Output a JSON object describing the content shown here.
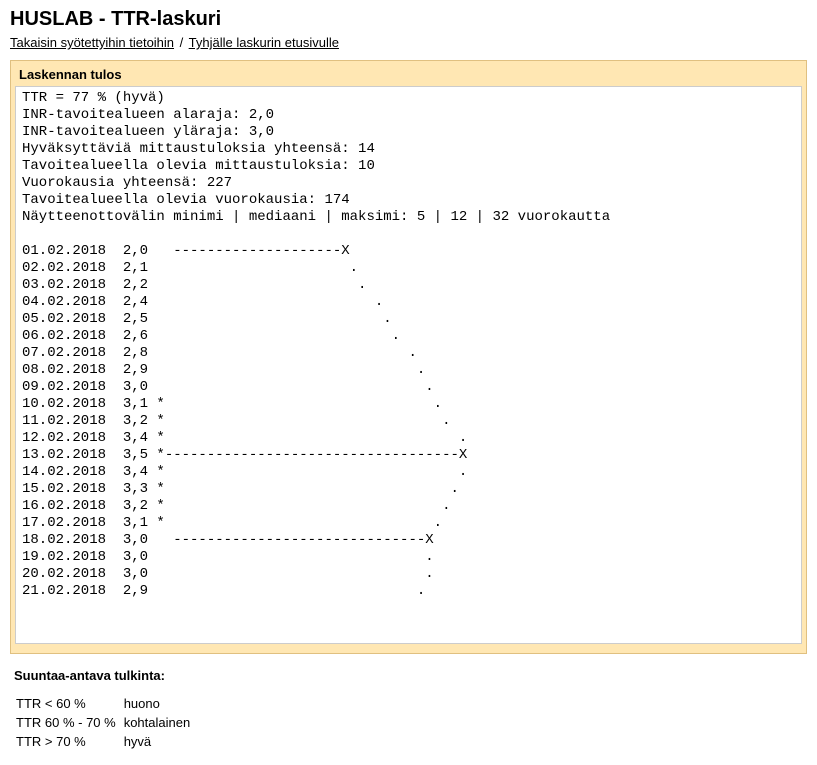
{
  "header": {
    "title": "HUSLAB - TTR-laskuri",
    "link_back": "Takaisin syötettyihin tietoihin",
    "link_empty": "Tyhjälle laskurin etusivulle",
    "separator": "/"
  },
  "panel": {
    "title": "Laskennan tulos"
  },
  "results": {
    "summary": [
      "TTR = 77 % (hyvä)",
      "INR-tavoitealueen alaraja: 2,0",
      "INR-tavoitealueen yläraja: 3,0",
      "Hyväksyttäviä mittaustuloksia yhteensä: 14",
      "Tavoitealueella olevia mittaustuloksia: 10",
      "Vuorokausia yhteensä: 227",
      "Tavoitealueella olevia vuorokausia: 174",
      "Näytteenottovälin minimi | mediaani | maksimi: 5 | 12 | 32 vuorokautta"
    ],
    "rows": [
      {
        "date": "01.02.2018",
        "value": "2,0",
        "flag": " ",
        "graph": " --------------------X                "
      },
      {
        "date": "02.02.2018",
        "value": "2,1",
        "flag": " ",
        "graph": "                      .               "
      },
      {
        "date": "03.02.2018",
        "value": "2,2",
        "flag": " ",
        "graph": "                       .              "
      },
      {
        "date": "04.02.2018",
        "value": "2,4",
        "flag": " ",
        "graph": "                         .            "
      },
      {
        "date": "05.02.2018",
        "value": "2,5",
        "flag": " ",
        "graph": "                          .           "
      },
      {
        "date": "06.02.2018",
        "value": "2,6",
        "flag": " ",
        "graph": "                           .          "
      },
      {
        "date": "07.02.2018",
        "value": "2,8",
        "flag": " ",
        "graph": "                             .        "
      },
      {
        "date": "08.02.2018",
        "value": "2,9",
        "flag": " ",
        "graph": "                              .       "
      },
      {
        "date": "09.02.2018",
        "value": "3,0",
        "flag": " ",
        "graph": "                               .      "
      },
      {
        "date": "10.02.2018",
        "value": "3,1",
        "flag": "*",
        "graph": "                                .     "
      },
      {
        "date": "11.02.2018",
        "value": "3,2",
        "flag": "*",
        "graph": "                                 .    "
      },
      {
        "date": "12.02.2018",
        "value": "3,4",
        "flag": "*",
        "graph": "                                   .  "
      },
      {
        "date": "13.02.2018",
        "value": "3,5",
        "flag": "*",
        "graph": "-----------------------------------X  "
      },
      {
        "date": "14.02.2018",
        "value": "3,4",
        "flag": "*",
        "graph": "                                   .  "
      },
      {
        "date": "15.02.2018",
        "value": "3,3",
        "flag": "*",
        "graph": "                                  .   "
      },
      {
        "date": "16.02.2018",
        "value": "3,2",
        "flag": "*",
        "graph": "                                 .    "
      },
      {
        "date": "17.02.2018",
        "value": "3,1",
        "flag": "*",
        "graph": "                                .     "
      },
      {
        "date": "18.02.2018",
        "value": "3,0",
        "flag": " ",
        "graph": " ------------------------------X      "
      },
      {
        "date": "19.02.2018",
        "value": "3,0",
        "flag": " ",
        "graph": "                               .      "
      },
      {
        "date": "20.02.2018",
        "value": "3,0",
        "flag": " ",
        "graph": "                               .      "
      },
      {
        "date": "21.02.2018",
        "value": "2,9",
        "flag": " ",
        "graph": "                              .       "
      }
    ]
  },
  "interpretation": {
    "title": "Suuntaa-antava tulkinta:",
    "rows": [
      {
        "range": "TTR < 60 %",
        "label": "huono"
      },
      {
        "range": "TTR 60 % - 70 %",
        "label": "kohtalainen"
      },
      {
        "range": "TTR > 70 %",
        "label": "hyvä"
      }
    ]
  }
}
